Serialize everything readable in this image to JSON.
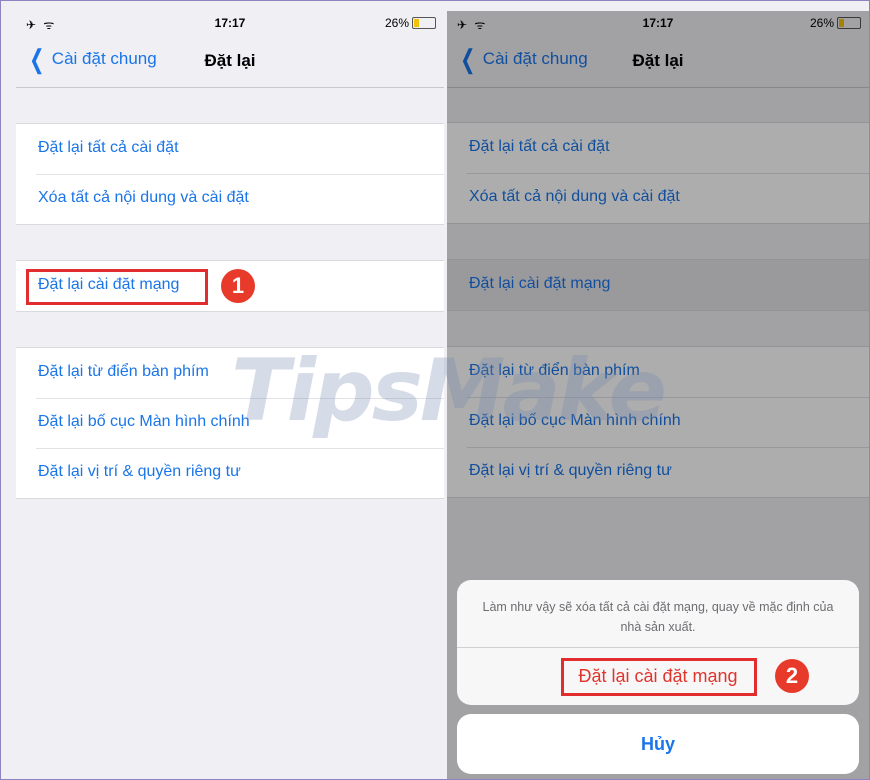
{
  "status_bar": {
    "time": "17:17",
    "battery": "26%",
    "battery_level": 0.26,
    "icons": "✈ ᯤ"
  },
  "nav": {
    "back_label": "Cài đặt chung",
    "title": "Đặt lại"
  },
  "groups": [
    [
      "Đặt lại tất cả cài đặt",
      "Xóa tất cả nội dung và cài đặt"
    ],
    [
      "Đặt lại cài đặt mạng"
    ],
    [
      "Đặt lại từ điển bàn phím",
      "Đặt lại bố cục Màn hình chính",
      "Đặt lại vị trí & quyền riêng tư"
    ]
  ],
  "dialog": {
    "message": "Làm như vậy sẽ xóa tất cả cài đặt mạng, quay về mặc định của nhà sản xuất.",
    "confirm_label": "Đặt lại cài đặt mạng",
    "cancel_label": "Hủy"
  },
  "annotations": {
    "step1": "1",
    "step2": "2"
  },
  "watermark": "TipsMake",
  "colors": {
    "accent": "#1a75e8",
    "destructive": "#e0342e",
    "marker": "#e12d2d",
    "badge": "#e83a2a"
  }
}
